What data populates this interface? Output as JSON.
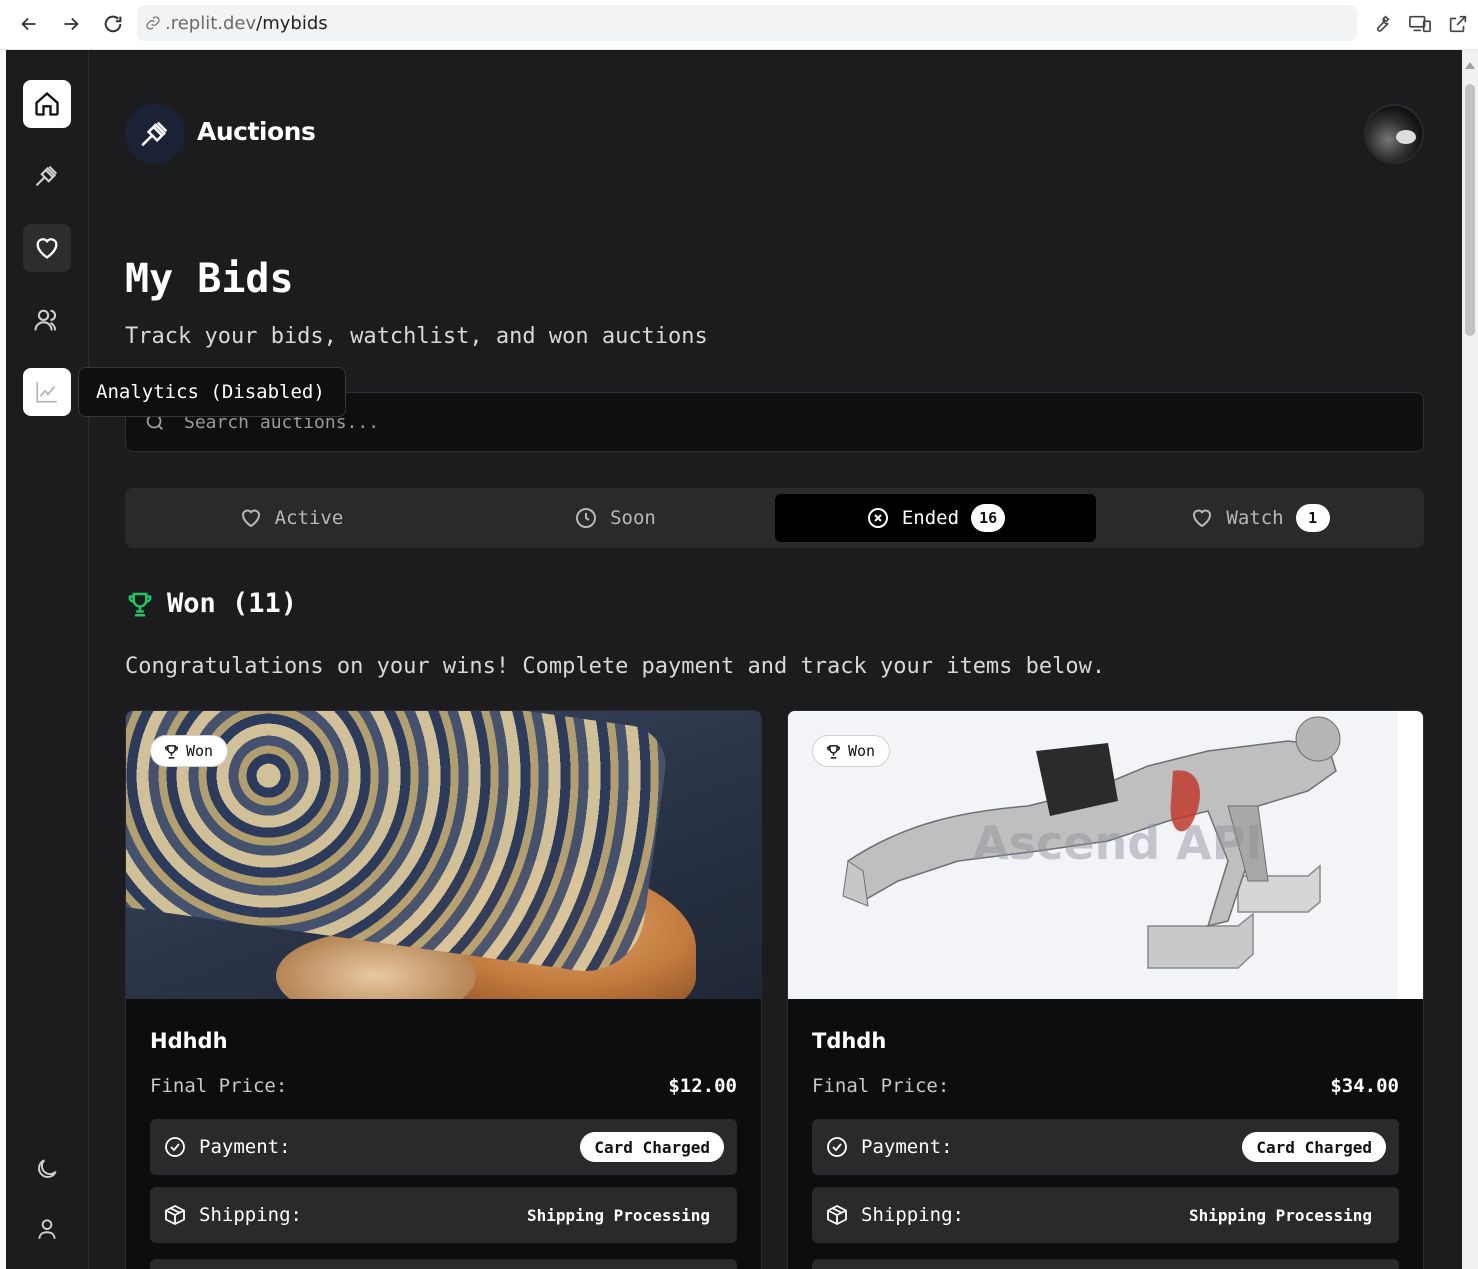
{
  "browser": {
    "url_host": ".replit.dev",
    "url_path": "/mybids"
  },
  "app": {
    "brand": "Auctions"
  },
  "sidebar": {
    "items": [
      {
        "icon": "home-icon",
        "state": "active"
      },
      {
        "icon": "gavel-icon",
        "state": "normal"
      },
      {
        "icon": "heart-icon",
        "state": "hover"
      },
      {
        "icon": "users-icon",
        "state": "normal"
      },
      {
        "icon": "chart-icon",
        "state": "active"
      }
    ],
    "tooltip": "Analytics (Disabled)"
  },
  "page": {
    "title": "My Bids",
    "subtitle": "Track your bids, watchlist, and won auctions"
  },
  "search": {
    "placeholder": "Search auctions..."
  },
  "tabs": [
    {
      "label": "Active",
      "icon": "heart-icon",
      "count": null,
      "active": false
    },
    {
      "label": "Soon",
      "icon": "clock-icon",
      "count": null,
      "active": false
    },
    {
      "label": "Ended",
      "icon": "x-circle-icon",
      "count": "16",
      "active": true
    },
    {
      "label": "Watch",
      "icon": "heart-icon",
      "count": "1",
      "active": false
    }
  ],
  "won": {
    "heading": "Won (11)",
    "description": "Congratulations on your wins! Complete payment and track your items below."
  },
  "cards": [
    {
      "badge": "Won",
      "title": "Hdhdh",
      "price_label": "Final Price:",
      "price": "$12.00",
      "payment_label": "Payment:",
      "payment_status": "Card Charged",
      "shipping_label": "Shipping:",
      "shipping_status": "Shipping Processing"
    },
    {
      "badge": "Won",
      "title": "Tdhdh",
      "price_label": "Final Price:",
      "price": "$34.00",
      "payment_label": "Payment:",
      "payment_status": "Card Charged",
      "shipping_label": "Shipping:",
      "shipping_status": "Shipping Processing",
      "image_watermark": "Ascend API"
    }
  ],
  "colors": {
    "background": "#1c1c1e",
    "accent_green": "#22c55e",
    "card_bg": "#0d0d0e"
  }
}
